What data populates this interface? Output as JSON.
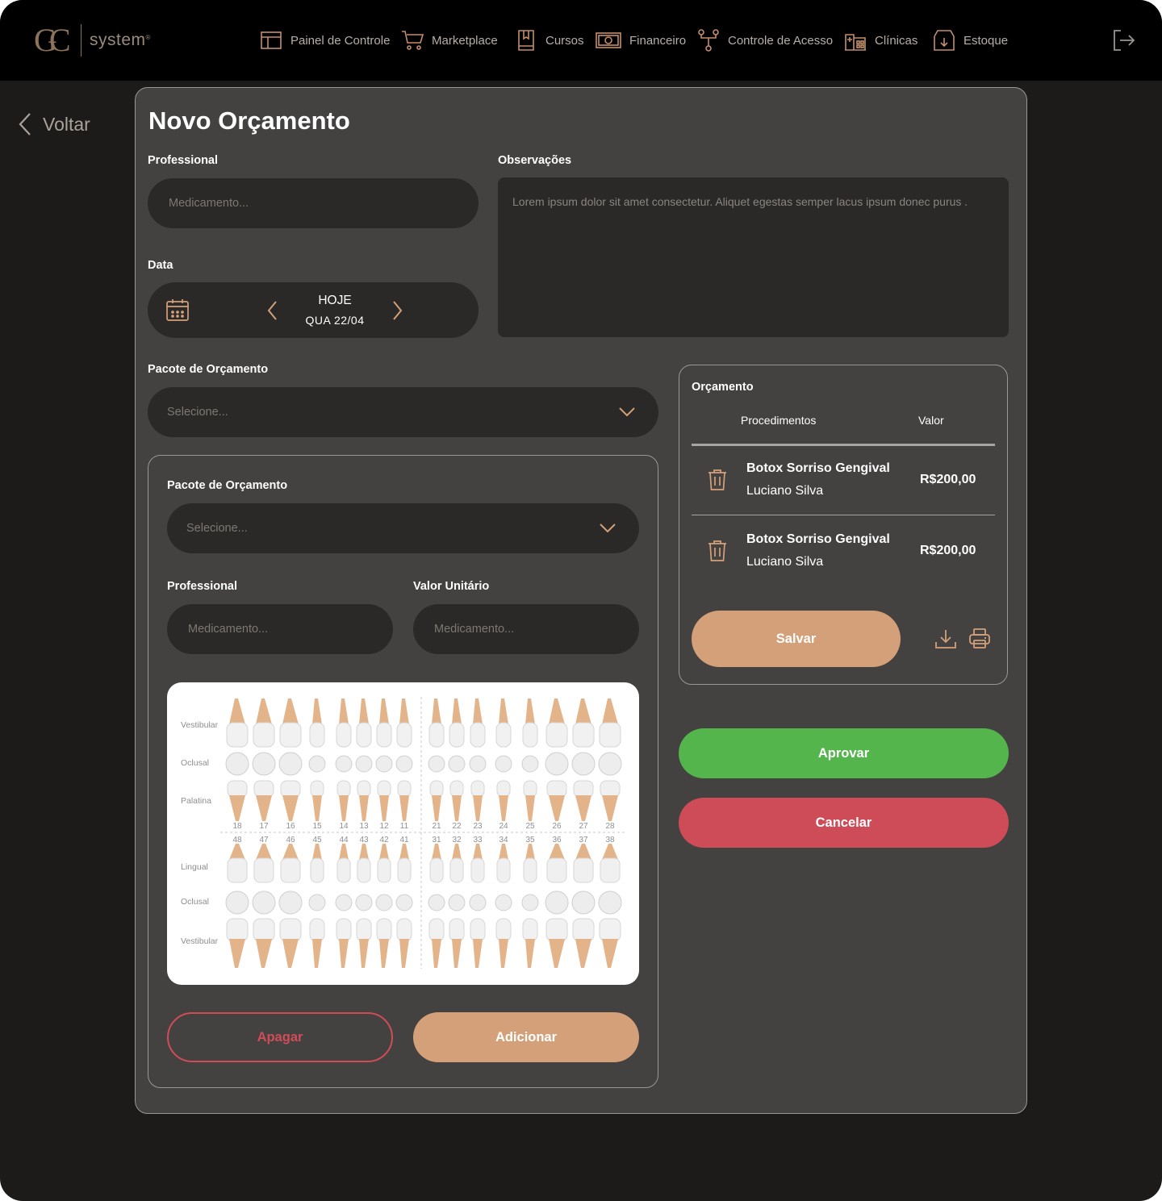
{
  "brand": {
    "mark": "GC",
    "name": "system",
    "reg": "®",
    "accent": "#d4a079",
    "nav_icon_color": "#c48e6a"
  },
  "nav": [
    {
      "label": "Painel de Controle",
      "icon": "layout-icon"
    },
    {
      "label": "Marketplace",
      "icon": "cart-icon"
    },
    {
      "label": "Cursos",
      "icon": "book-icon"
    },
    {
      "label": "Financeiro",
      "icon": "money-icon"
    },
    {
      "label": "Controle de Acesso",
      "icon": "flow-icon"
    },
    {
      "label": "Clínicas",
      "icon": "building-icon"
    },
    {
      "label": "Estoque",
      "icon": "download-box-icon"
    }
  ],
  "back": {
    "label": "Voltar"
  },
  "page": {
    "title": "Novo Orçamento"
  },
  "form": {
    "professional_label": "Professional",
    "professional_placeholder": "Medicamento...",
    "observacoes_label": "Observações",
    "observacoes_text": "Lorem ipsum dolor sit amet consectetur. Aliquet egestas semper lacus ipsum donec purus .",
    "data_label": "Data",
    "date_top": "HOJE",
    "date_bottom": "QUA 22/04",
    "pacote_label": "Pacote de Orçamento",
    "pacote_placeholder": "Selecione..."
  },
  "sub": {
    "pacote_label": "Pacote de Orçamento",
    "pacote_placeholder": "Selecione...",
    "professional_label": "Professional",
    "professional_placeholder": "Medicamento...",
    "valor_label": "Valor Unitário",
    "valor_placeholder": "Medicamento...",
    "odontogram": {
      "upper_rows": [
        "Vestibular",
        "Oclusal",
        "Palatina"
      ],
      "lower_rows": [
        "Lingual",
        "Oclusal",
        "Vestibular"
      ],
      "upper_numbers": [
        "18",
        "17",
        "16",
        "15",
        "14",
        "13",
        "12",
        "11",
        "21",
        "22",
        "23",
        "24",
        "25",
        "26",
        "27",
        "28"
      ],
      "lower_numbers": [
        "48",
        "47",
        "46",
        "45",
        "44",
        "43",
        "42",
        "41",
        "31",
        "32",
        "33",
        "34",
        "35",
        "36",
        "37",
        "38"
      ]
    },
    "apagar": "Apagar",
    "adicionar": "Adicionar"
  },
  "quote": {
    "title": "Orçamento",
    "col_proc": "Procedimentos",
    "col_valor": "Valor",
    "items": [
      {
        "name": "Botox Sorriso Gengival",
        "professional": "Luciano Silva",
        "value": "R$200,00"
      },
      {
        "name": "Botox Sorriso Gengival",
        "professional": "Luciano Silva",
        "value": "R$200,00"
      }
    ],
    "save": "Salvar"
  },
  "actions": {
    "approve": "Aprovar",
    "cancel": "Cancelar"
  }
}
